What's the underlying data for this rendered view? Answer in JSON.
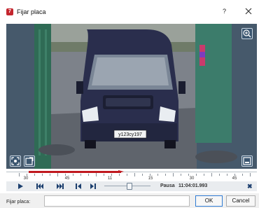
{
  "window": {
    "title": "Fijar placa",
    "help_label": "?",
    "app_icon_letter": "7"
  },
  "video": {
    "license_plate_text": "у123су197",
    "icons": [
      "zoom-icon",
      "fit-screen-icon",
      "snapshot-icon",
      "export-icon"
    ]
  },
  "timeline": {
    "tick_labels": [
      "30",
      "45",
      "11",
      "15",
      "30",
      "45"
    ],
    "played_fraction": 0.44
  },
  "controls": {
    "status": "Pausa",
    "timecode": "11:04:01.993",
    "clear_label": "✖",
    "speed_fraction": 0.55,
    "icons": [
      "play-icon",
      "skip-start-icon",
      "skip-end-icon",
      "step-back-icon",
      "step-forward-icon"
    ]
  },
  "form": {
    "plate_label": "Fijar placa:",
    "plate_value": "",
    "ok_label": "OK",
    "cancel_label": "Cancel"
  },
  "colors": {
    "accent": "#1c3f6e",
    "timeline_red": "#c0191f",
    "frame_bg": "#44586b"
  }
}
